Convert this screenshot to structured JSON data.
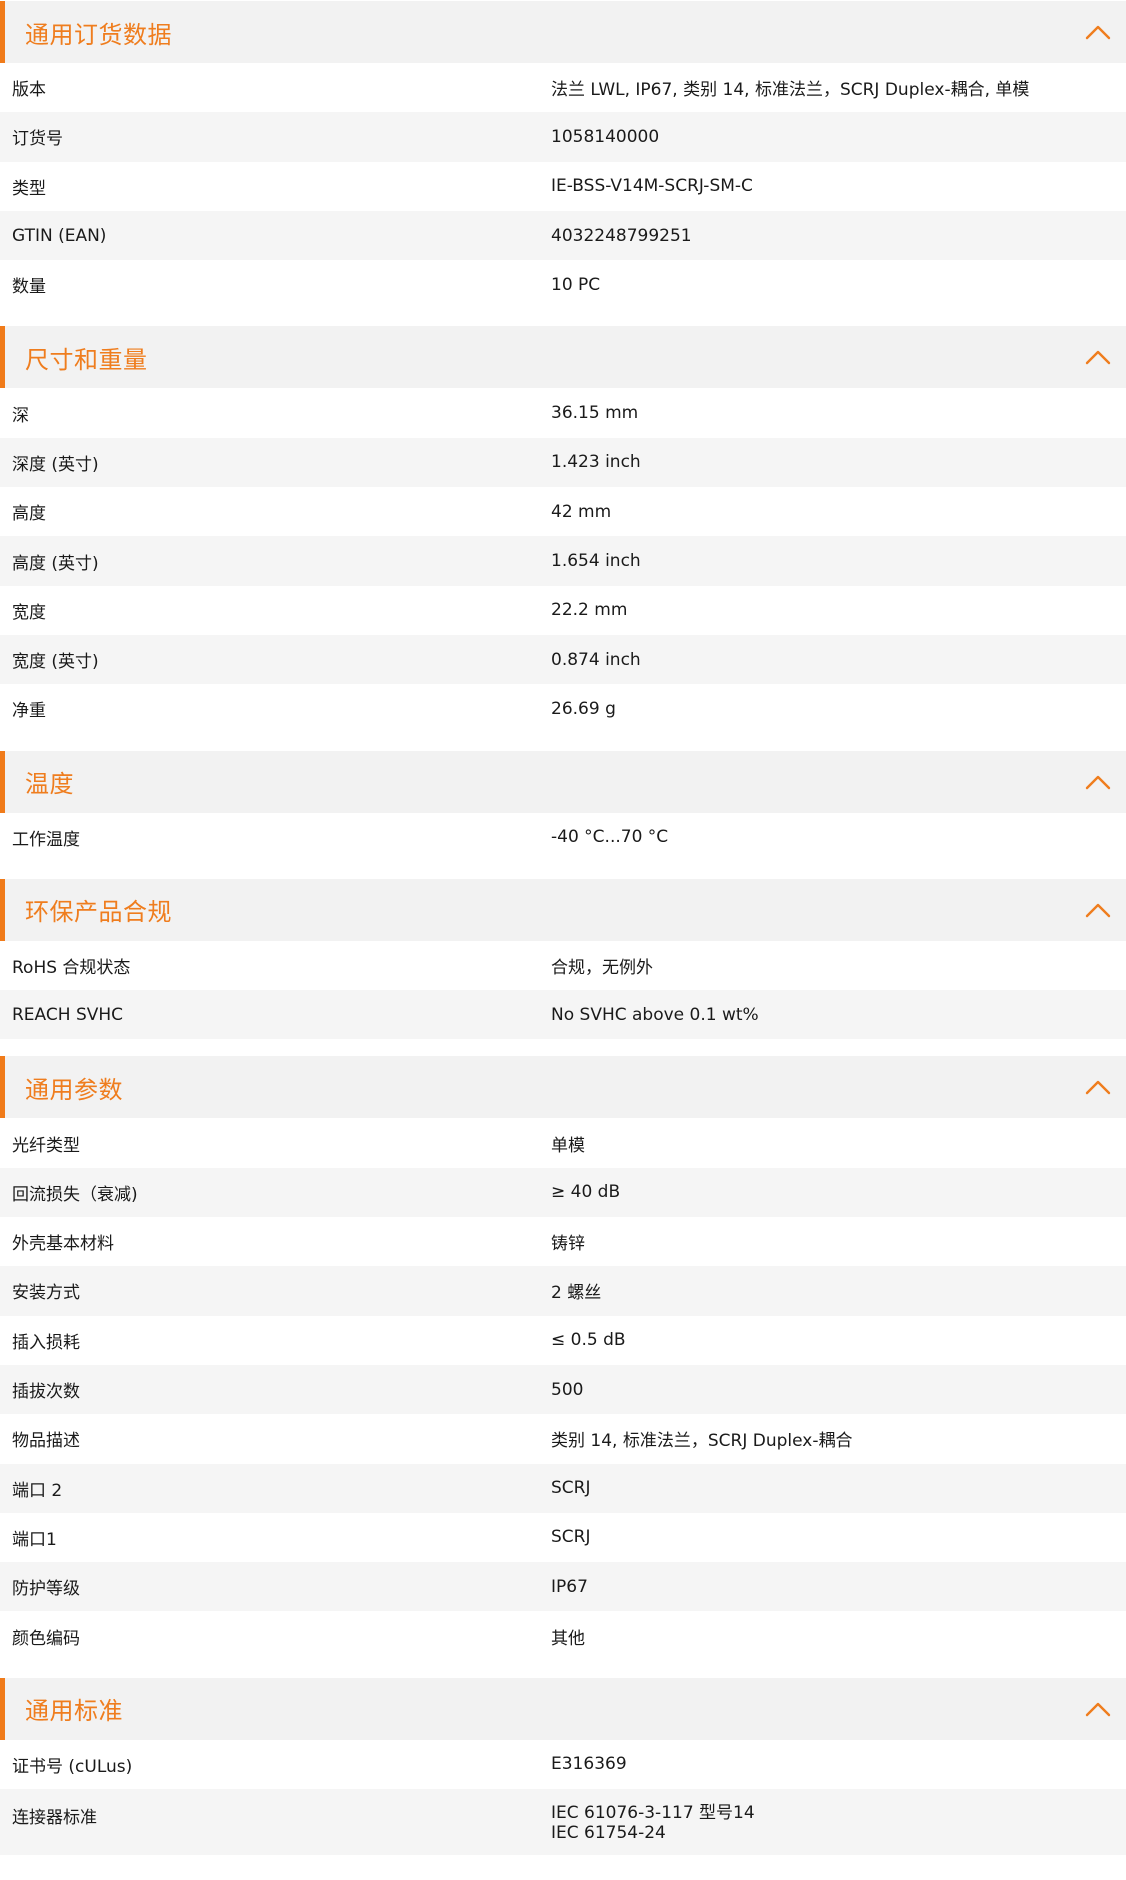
{
  "accent_color": "#ef7d1e",
  "collapse_icon": "chevron-up-icon",
  "sections": [
    {
      "title": "通用订货数据",
      "rows": [
        {
          "label": "版本",
          "value": "法兰 LWL, IP67, 类别 14, 标准法兰，SCRJ Duplex-耦合, 单模"
        },
        {
          "label": "订货号",
          "value": "1058140000"
        },
        {
          "label": "类型",
          "value": "IE-BSS-V14M-SCRJ-SM-C"
        },
        {
          "label": "GTIN (EAN)",
          "value": "4032248799251"
        },
        {
          "label": "数量",
          "value": "10  PC"
        }
      ]
    },
    {
      "title": "尺寸和重量",
      "rows": [
        {
          "label": "深",
          "value": "36.15  mm"
        },
        {
          "label": "深度 (英寸)",
          "value": "1.423  inch"
        },
        {
          "label": "高度",
          "value": "42  mm"
        },
        {
          "label": "高度 (英寸)",
          "value": "1.654  inch"
        },
        {
          "label": "宽度",
          "value": "22.2  mm"
        },
        {
          "label": "宽度 (英寸)",
          "value": "0.874  inch"
        },
        {
          "label": "净重",
          "value": "26.69  g"
        }
      ]
    },
    {
      "title": "温度",
      "rows": [
        {
          "label": "工作温度",
          "value": "-40 °C...70 °C"
        }
      ]
    },
    {
      "title": "环保产品合规",
      "rows": [
        {
          "label": "RoHS 合规状态",
          "value": "合规，无例外"
        },
        {
          "label": "REACH SVHC",
          "value": "No SVHC above 0.1 wt%"
        }
      ]
    },
    {
      "title": "通用参数",
      "rows": [
        {
          "label": "光纤类型",
          "value": "单模"
        },
        {
          "label": "回流损失（衰减)",
          "value": "≥ 40 dB"
        },
        {
          "label": "外壳基本材料",
          "value": "铸锌"
        },
        {
          "label": "安装方式",
          "value": "2 螺丝"
        },
        {
          "label": "插入损耗",
          "value": "≤ 0.5 dB"
        },
        {
          "label": "插拔次数",
          "value": "500"
        },
        {
          "label": "物品描述",
          "value": "类别 14, 标准法兰，SCRJ Duplex-耦合"
        },
        {
          "label": "端口 2",
          "value": "SCRJ"
        },
        {
          "label": "端口1",
          "value": "SCRJ"
        },
        {
          "label": "防护等级",
          "value": "IP67"
        },
        {
          "label": "颜色编码",
          "value": "其他"
        }
      ]
    },
    {
      "title": "通用标准",
      "rows": [
        {
          "label": "证书号 (cULus)",
          "value": "E316369"
        },
        {
          "label": "连接器标准",
          "values": [
            "IEC 61076-3-117 型号14",
            "IEC 61754-24"
          ]
        }
      ]
    }
  ]
}
